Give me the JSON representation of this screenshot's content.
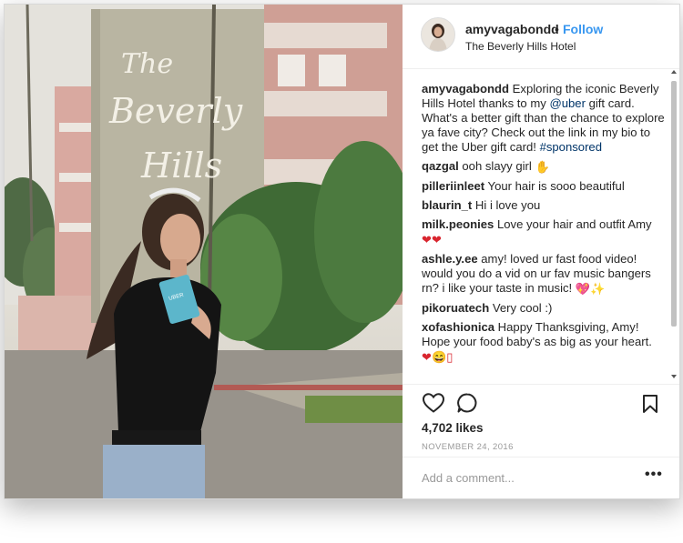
{
  "post": {
    "username": "amyvagabondd",
    "separator": "•",
    "follow_label": "Follow",
    "location": "The Beverly Hills Hotel",
    "building_sign": [
      "The",
      "Beverly",
      "Hills"
    ],
    "card_brand": "UBER"
  },
  "caption": {
    "username": "amyvagabondd",
    "text_before": " Exploring the iconic Beverly Hills Hotel thanks to my ",
    "mention": "@uber",
    "text_after": " gift card. What's a better gift than the chance to explore ya fave city? Check out the link in my bio to get the Uber gift card! ",
    "hashtag": "#sponsored"
  },
  "comments": [
    {
      "user": "qazgal",
      "text": " ooh slayy girl ",
      "emoji": "✋"
    },
    {
      "user": "pilleriinleet",
      "text": " Your hair is sooo beautiful",
      "emoji": ""
    },
    {
      "user": "blaurin_t",
      "text": " Hi i love you",
      "emoji": ""
    },
    {
      "user": "milk.peonies",
      "text": " Love your hair and outfit Amy ",
      "emoji": "❤❤"
    },
    {
      "user": "ashle.y.ee",
      "text": " amy! loved ur fast food video! would you do a vid on ur fav music bangers rn? i like your taste in music! ",
      "emoji": "💖✨"
    },
    {
      "user": "pikoruatech",
      "text": " Very cool :)",
      "emoji": ""
    },
    {
      "user": "xofashionica",
      "text": " Happy Thanksgiving, Amy! Hope your food baby's as big as your heart. ",
      "emoji": "❤😄▯"
    }
  ],
  "actions": {
    "icons": [
      "heart-icon",
      "comment-icon",
      "bookmark-icon"
    ],
    "likes": "4,702 likes",
    "date": "NOVEMBER 24, 2016"
  },
  "add_comment": {
    "placeholder": "Add a comment...",
    "more_label": "•••"
  },
  "colors": {
    "link": "#3897f0",
    "text": "#262626",
    "muted": "#999999",
    "heart": "#ed4956"
  }
}
